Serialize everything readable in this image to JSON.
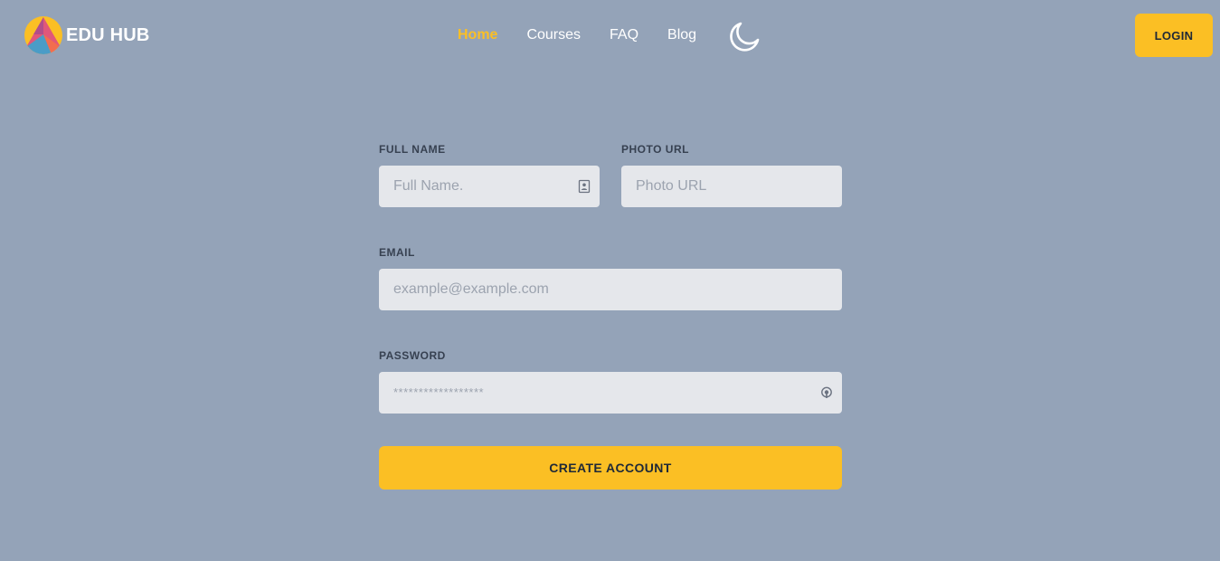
{
  "brand": {
    "name": "EDU HUB",
    "logo_icon": "edu-hub-logo"
  },
  "nav": {
    "links": [
      {
        "label": "Home",
        "active": true
      },
      {
        "label": "Courses",
        "active": false
      },
      {
        "label": "FAQ",
        "active": false
      },
      {
        "label": "Blog",
        "active": false
      }
    ],
    "theme_icon": "moon-icon",
    "login_label": "LOGIN"
  },
  "form": {
    "full_name": {
      "label": "FULL NAME",
      "placeholder": "Full Name.",
      "value": ""
    },
    "photo_url": {
      "label": "PHOTO URL",
      "placeholder": "Photo URL",
      "value": ""
    },
    "email": {
      "label": "EMAIL",
      "placeholder": "example@example.com",
      "value": ""
    },
    "password": {
      "label": "PASSWORD",
      "placeholder": "******************",
      "value": ""
    },
    "submit_label": "CREATE ACCOUNT"
  },
  "colors": {
    "background": "#94a3b8",
    "accent": "#fbbf24",
    "input_bg": "#e5e7eb",
    "label": "#374151"
  }
}
